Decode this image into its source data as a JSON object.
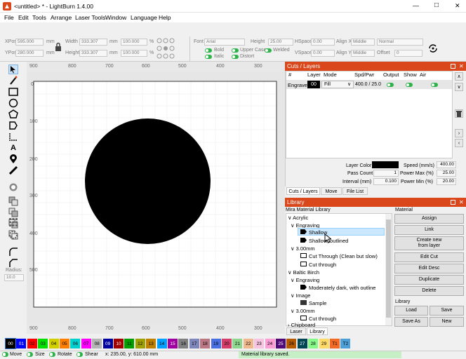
{
  "window": {
    "title": "<untitled> * - LightBurn 1.4.00",
    "min": "—",
    "max": "□",
    "close": "✕"
  },
  "menu": [
    "File",
    "Edit",
    "Tools",
    "Arrange",
    "Laser Tools",
    "Window",
    "Language",
    "Help"
  ],
  "props": {
    "xpos_label": "XPos",
    "xpos": "595.000",
    "ypos_label": "YPos",
    "ypos": "280.000",
    "unit": "mm",
    "width_label": "Width",
    "width": "333.307",
    "height_label": "Height",
    "height": "333.307",
    "scale_w": "100.000",
    "scale_h": "100.000",
    "pct": "%",
    "font_label": "Font",
    "font": "Arial",
    "height2_label": "Height",
    "height2": "25.00",
    "hspace_label": "HSpace",
    "hspace": "0.00",
    "vspace_label": "VSpace",
    "vspace": "0.00",
    "alignx_label": "Align X",
    "alignx": "Middle",
    "aligny_label": "Align Y",
    "aligny": "Middle",
    "mode": "Normal",
    "offset_label": "Offset",
    "offset": "0",
    "bold": "Bold",
    "italic": "Italic",
    "uppercase": "Upper Case",
    "distort": "Distort",
    "welded": "Welded"
  },
  "ruler_top": [
    "900",
    "800",
    "700",
    "600",
    "500",
    "400",
    "300"
  ],
  "ruler_bottom": [
    "900",
    "800",
    "700",
    "600",
    "500",
    "400",
    "300"
  ],
  "ruler_left": [
    "0",
    "100",
    "200",
    "300",
    "400",
    "500"
  ],
  "radius_label": "Radius:",
  "radius": "10.0",
  "cuts": {
    "title": "Cuts / Layers",
    "headers": [
      "#",
      "Layer",
      "Mode",
      "Spd/Pwr",
      "Output",
      "Show",
      "Air"
    ],
    "row": {
      "name": "Engrave",
      "layer": "00",
      "mode": "Fill",
      "spdpwr": "400.0 / 25.0"
    },
    "layer_color_label": "Layer Color",
    "speed_label": "Speed (mm/s)",
    "speed": "400.00",
    "passes_label": "Pass Count",
    "passes": "1",
    "pmax_label": "Power Max (%)",
    "pmax": "25.00",
    "interval_label": "Interval (mm)",
    "interval": "0.100",
    "pmin_label": "Power Min (%)",
    "pmin": "20.00",
    "colors": {
      "layer": "#000000",
      "accent": "#d9471b",
      "on": "#2cb34a"
    }
  },
  "cuts_tabs": [
    "Cuts / Layers",
    "Move",
    "File List"
  ],
  "library": {
    "title": "Library",
    "lib_name": "Mira Material Library",
    "material_label": "Material",
    "tree": [
      {
        "t": "Acrylic",
        "lvl": 0,
        "arrow": "∨"
      },
      {
        "t": "Engraving",
        "lvl": 1,
        "arrow": "∨"
      },
      {
        "t": "Shallow",
        "lvl": 2,
        "sel": true
      },
      {
        "t": "Shallow, outlined",
        "lvl": 2
      },
      {
        "t": "3.00mm",
        "lvl": 1,
        "arrow": "∨"
      },
      {
        "t": "Cut Through (Clean but slow)",
        "lvl": 2
      },
      {
        "t": "Cut through",
        "lvl": 2
      },
      {
        "t": "Baltic Birch",
        "lvl": 0,
        "arrow": "∨"
      },
      {
        "t": "Engraving",
        "lvl": 1,
        "arrow": "∨"
      },
      {
        "t": "Moderately dark, with outline",
        "lvl": 2
      },
      {
        "t": "Image",
        "lvl": 1,
        "arrow": "∨"
      },
      {
        "t": "Sample",
        "lvl": 2,
        "img": true
      },
      {
        "t": "3.00mm",
        "lvl": 1,
        "arrow": "∨"
      },
      {
        "t": "Cut through",
        "lvl": 2
      },
      {
        "t": "Chipboard",
        "lvl": 0,
        "arrow": ">"
      }
    ],
    "buttons": {
      "assign": "Assign",
      "link": "Link",
      "create": "Create new\nfrom layer",
      "edit": "Edit Cut",
      "editdesc": "Edit Desc",
      "duplicate": "Duplicate",
      "delete": "Delete"
    },
    "library_label": "Library",
    "load": "Load",
    "save": "Save",
    "saveas": "Save As",
    "new": "New"
  },
  "lib_tabs": [
    "Laser",
    "Library"
  ],
  "palette": [
    {
      "l": "00",
      "c": "#000000",
      "fg": "#fff"
    },
    {
      "l": "01",
      "c": "#0000ff",
      "fg": "#fff"
    },
    {
      "l": "02",
      "c": "#ff0000",
      "fg": "#000"
    },
    {
      "l": "03",
      "c": "#00e000",
      "fg": "#000"
    },
    {
      "l": "04",
      "c": "#d0d000",
      "fg": "#000"
    },
    {
      "l": "05",
      "c": "#ff8000",
      "fg": "#000"
    },
    {
      "l": "06",
      "c": "#00d0d0",
      "fg": "#000"
    },
    {
      "l": "07",
      "c": "#ff00ff",
      "fg": "#000"
    },
    {
      "l": "08",
      "c": "#b4b4b4",
      "fg": "#000"
    },
    {
      "l": "09",
      "c": "#0000a0",
      "fg": "#fff"
    },
    {
      "l": "10",
      "c": "#a00000",
      "fg": "#fff"
    },
    {
      "l": "11",
      "c": "#00a000",
      "fg": "#000"
    },
    {
      "l": "12",
      "c": "#a0a000",
      "fg": "#000"
    },
    {
      "l": "13",
      "c": "#c08000",
      "fg": "#000"
    },
    {
      "l": "14",
      "c": "#00a0ff",
      "fg": "#000"
    },
    {
      "l": "15",
      "c": "#a000a0",
      "fg": "#fff"
    },
    {
      "l": "16",
      "c": "#808080",
      "fg": "#000"
    },
    {
      "l": "17",
      "c": "#7d87b9",
      "fg": "#000"
    },
    {
      "l": "18",
      "c": "#bb7784",
      "fg": "#000"
    },
    {
      "l": "19",
      "c": "#4a6fe3",
      "fg": "#000"
    },
    {
      "l": "20",
      "c": "#d33f6a",
      "fg": "#000"
    },
    {
      "l": "21",
      "c": "#8cd78c",
      "fg": "#000"
    },
    {
      "l": "22",
      "c": "#f0b98d",
      "fg": "#000"
    },
    {
      "l": "23",
      "c": "#f6c4e1",
      "fg": "#000"
    },
    {
      "l": "24",
      "c": "#fa9ed4",
      "fg": "#000"
    },
    {
      "l": "25",
      "c": "#500a78",
      "fg": "#fff"
    },
    {
      "l": "26",
      "c": "#b45a00",
      "fg": "#000"
    },
    {
      "l": "27",
      "c": "#004754",
      "fg": "#fff"
    },
    {
      "l": "28",
      "c": "#86fa88",
      "fg": "#000"
    },
    {
      "l": "29",
      "c": "#ffdb66",
      "fg": "#000"
    },
    {
      "l": "T1",
      "c": "#f36926",
      "fg": "#000"
    },
    {
      "l": "T2",
      "c": "#4c9fd7",
      "fg": "#000"
    }
  ],
  "status": {
    "move": "Move",
    "size": "Size",
    "rotate": "Rotate",
    "shear": "Shear",
    "coords": "x: 235.00, y: 610.00 mm",
    "message": "Material library saved."
  }
}
